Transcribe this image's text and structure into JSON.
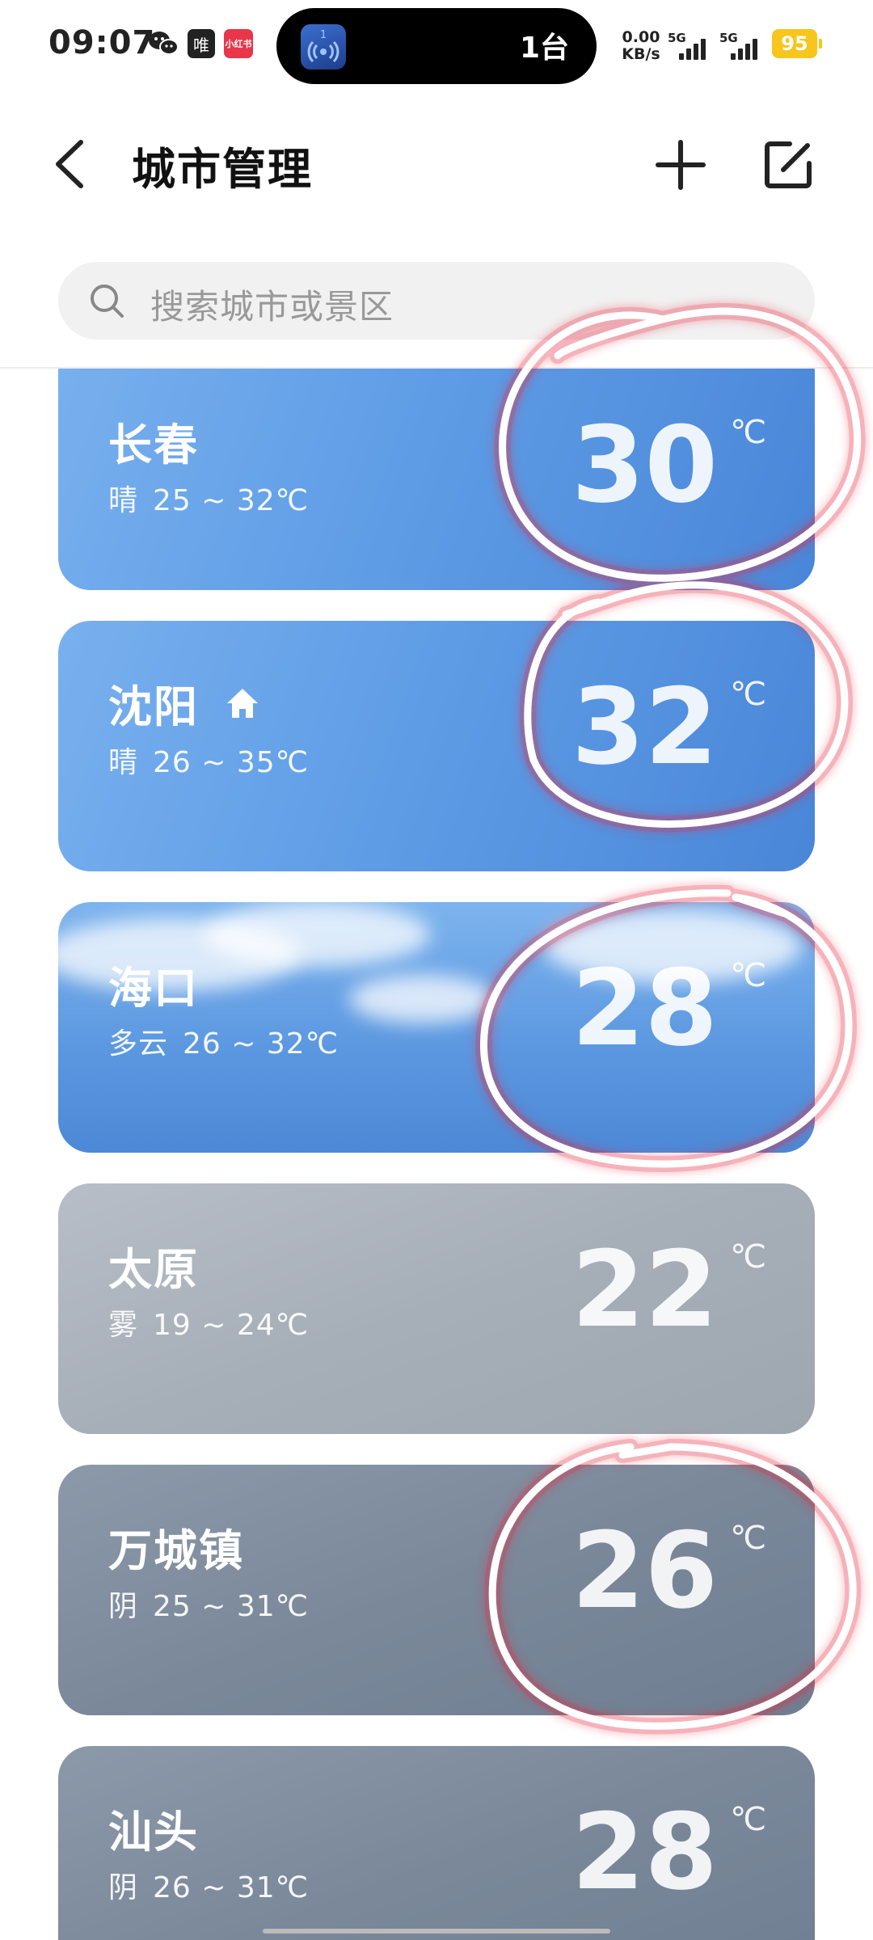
{
  "status_bar": {
    "time": "09:07",
    "island_label": "1台",
    "island_app_number": "1",
    "net_speed_value": "0.00",
    "net_speed_unit": "KB/s",
    "signal1_label": "5G",
    "signal2_label": "5G",
    "battery": "95",
    "app_badge_red": "小红书",
    "app_badge_dark": "唯"
  },
  "header": {
    "title": "城市管理"
  },
  "search": {
    "placeholder": "搜索城市或景区"
  },
  "cities": [
    {
      "name": "长春",
      "condition": "晴",
      "range": "25 ~ 32℃",
      "temp": "30",
      "unit": "℃",
      "is_home": false,
      "style": "sunny"
    },
    {
      "name": "沈阳",
      "condition": "晴",
      "range": "26 ~ 35℃",
      "temp": "32",
      "unit": "℃",
      "is_home": true,
      "style": "sunny"
    },
    {
      "name": "海口",
      "condition": "多云",
      "range": "26 ~ 32℃",
      "temp": "28",
      "unit": "℃",
      "is_home": false,
      "style": "cloudy"
    },
    {
      "name": "太原",
      "condition": "雾",
      "range": "19 ~ 24℃",
      "temp": "22",
      "unit": "℃",
      "is_home": false,
      "style": "fog"
    },
    {
      "name": "万城镇",
      "condition": "阴",
      "range": "25 ~ 31℃",
      "temp": "26",
      "unit": "℃",
      "is_home": false,
      "style": "overcast"
    },
    {
      "name": "汕头",
      "condition": "阴",
      "range": "26 ~ 31℃",
      "temp": "28",
      "unit": "℃",
      "is_home": false,
      "style": "overcast"
    }
  ],
  "colors": {
    "annotation_stroke": "#ffffff",
    "annotation_glow": "#e8283a",
    "battery": "#f7c51c"
  }
}
